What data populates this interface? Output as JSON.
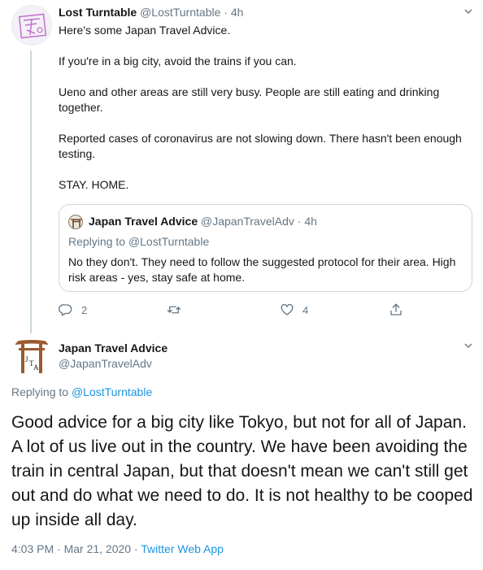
{
  "tweet1": {
    "author_name": "Lost Turntable",
    "author_handle": "@LostTurntable",
    "separator": "·",
    "time": "4h",
    "paragraphs": [
      "Here's some Japan Travel Advice.",
      "If you're in a big city, avoid the trains if you can.",
      "Ueno and other areas are still very busy. People are still eating and drinking together.",
      "Reported cases of coronavirus are not slowing down. There hasn't been enough testing.",
      "STAY. HOME."
    ],
    "quote": {
      "author_name": "Japan Travel Advice",
      "author_handle": "@JapanTravelAdv",
      "separator": "·",
      "time": "4h",
      "replying_prefix": "Replying to",
      "replying_to": "@LostTurntable",
      "text": "No they don't. They need to follow the suggested protocol for their area. High risk areas - yes, stay safe at home."
    },
    "actions": {
      "reply_count": "2",
      "retweet_count": "",
      "like_count": "4"
    },
    "icons": [
      "chevron-down-icon",
      "reply-icon",
      "retweet-icon",
      "like-icon",
      "share-icon"
    ]
  },
  "tweet2": {
    "author_name": "Japan Travel Advice",
    "author_handle": "@JapanTravelAdv",
    "avatar_letters": [
      "J",
      "T",
      "A"
    ],
    "replying_prefix": "Replying to",
    "replying_to": "@LostTurntable",
    "text": "Good advice for a big city like Tokyo, but not for all of Japan. A lot of us live out in the country. We have been avoiding the train in central Japan, but that doesn't mean we can't still get out and do what we need to do. It is not healthy to be cooped up inside all day.",
    "timestamp": "4:03 PM · Mar 21, 2020 ·",
    "source": "Twitter Web App"
  },
  "colors": {
    "text": "#14171a",
    "secondary": "#657786",
    "link": "#1b95e0",
    "border": "#ccd6dd",
    "torii": "#9b5a2e"
  }
}
